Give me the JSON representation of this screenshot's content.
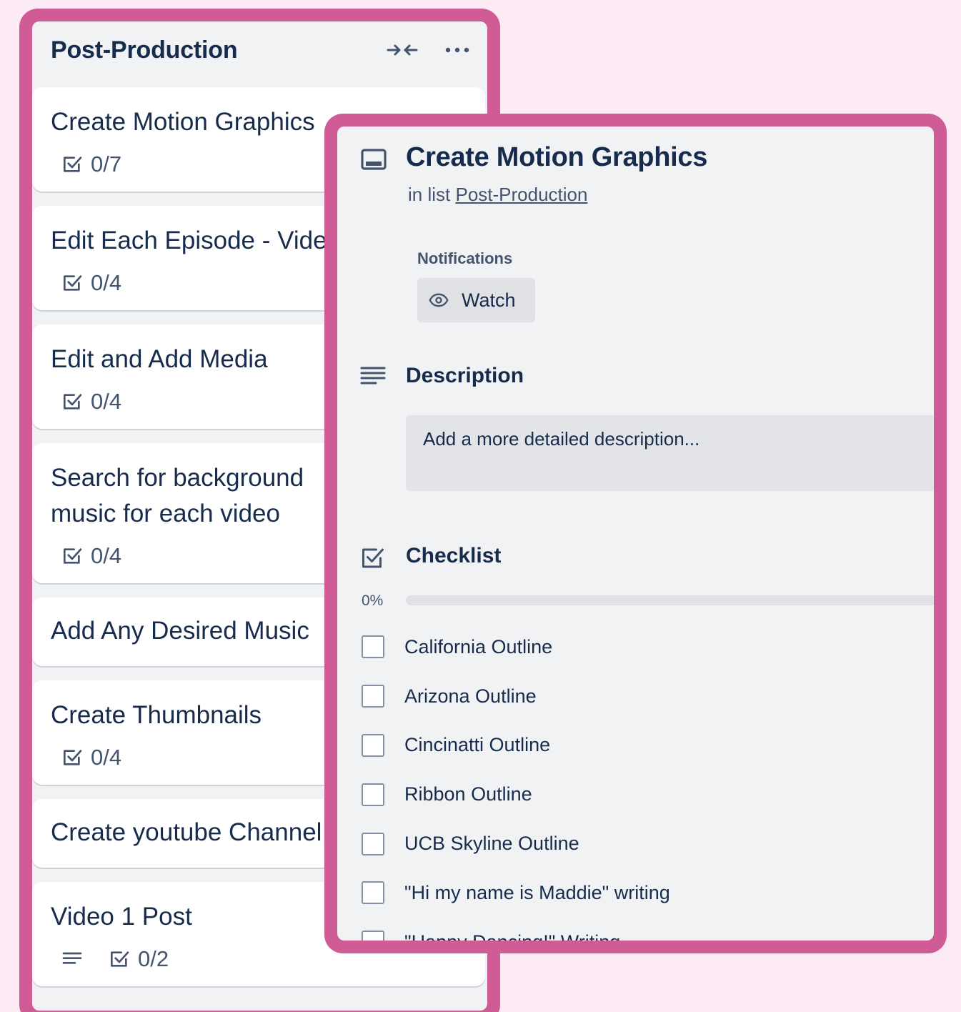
{
  "colors": {
    "page_background": "#fcebf5",
    "frame_highlight": "#cf5c95",
    "panel_background": "#f1f2f4",
    "text_primary": "#172b4d",
    "text_secondary": "#44546f"
  },
  "list": {
    "title": "Post-Production",
    "icons": [
      "collapse-icon",
      "more-icon"
    ],
    "cards": [
      {
        "title": "Create Motion Graphics",
        "checklist": "0/7"
      },
      {
        "title": "Edit Each Episode - Video",
        "checklist": "0/4"
      },
      {
        "title": "Edit and Add Media",
        "checklist": "0/4"
      },
      {
        "title": "Search for background music for each video",
        "checklist": "0/4"
      },
      {
        "title": "Add Any Desired Music"
      },
      {
        "title": "Create Thumbnails",
        "checklist": "0/4"
      },
      {
        "title": "Create youtube Channel"
      },
      {
        "title": "Video 1 Post",
        "checklist": "0/2"
      }
    ]
  },
  "detail": {
    "title": "Create Motion Graphics",
    "in_list_prefix": "in list",
    "list_name": "Post-Production",
    "notifications_label": "Notifications",
    "watch_label": "Watch",
    "description_heading": "Description",
    "description_placeholder": "Add a more detailed description...",
    "checklist_heading": "Checklist",
    "progress_text": "0%",
    "progress_fraction": 0,
    "checklist_items": [
      {
        "label": "California Outline",
        "checked": false
      },
      {
        "label": "Arizona Outline",
        "checked": false
      },
      {
        "label": "Cincinatti Outline",
        "checked": false
      },
      {
        "label": "Ribbon Outline",
        "checked": false
      },
      {
        "label": "UCB Skyline Outline",
        "checked": false
      },
      {
        "label": "\"Hi my name is Maddie\" writing",
        "checked": false
      },
      {
        "label": "\"Happy Dancing!\" Writing",
        "checked": false
      }
    ]
  }
}
